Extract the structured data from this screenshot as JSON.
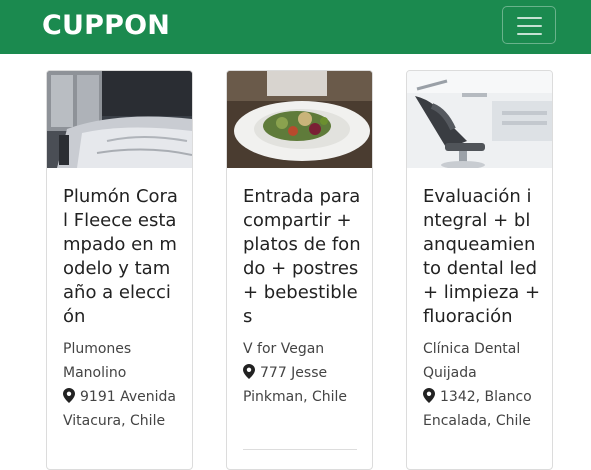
{
  "navbar": {
    "brand": "CUPPON",
    "toggle_icon": "hamburger-menu-icon",
    "background": "#1b8a4f"
  },
  "cards": [
    {
      "image_subject": "bed-with-blanket",
      "title": "Plumón Coral Fleece estampado en modelo y tamaño a elección",
      "merchant": "Plumones Manolino",
      "location_icon": "map-marker-icon",
      "address": "9191 Avenida Vitacura, Chile"
    },
    {
      "image_subject": "plated-salad",
      "title": "Entrada para compartir + platos de fondo + postres + bebestibles",
      "merchant": "V for Vegan",
      "location_icon": "map-marker-icon",
      "address": "777 Jesse Pinkman, Chile"
    },
    {
      "image_subject": "dental-chair",
      "title": "Evaluación integral + blanqueamiento dental led + limpieza + fluoración",
      "merchant": "Clínica Dental Quijada",
      "location_icon": "map-marker-icon",
      "address": "1342, Blanco Encalada, Chile"
    }
  ]
}
